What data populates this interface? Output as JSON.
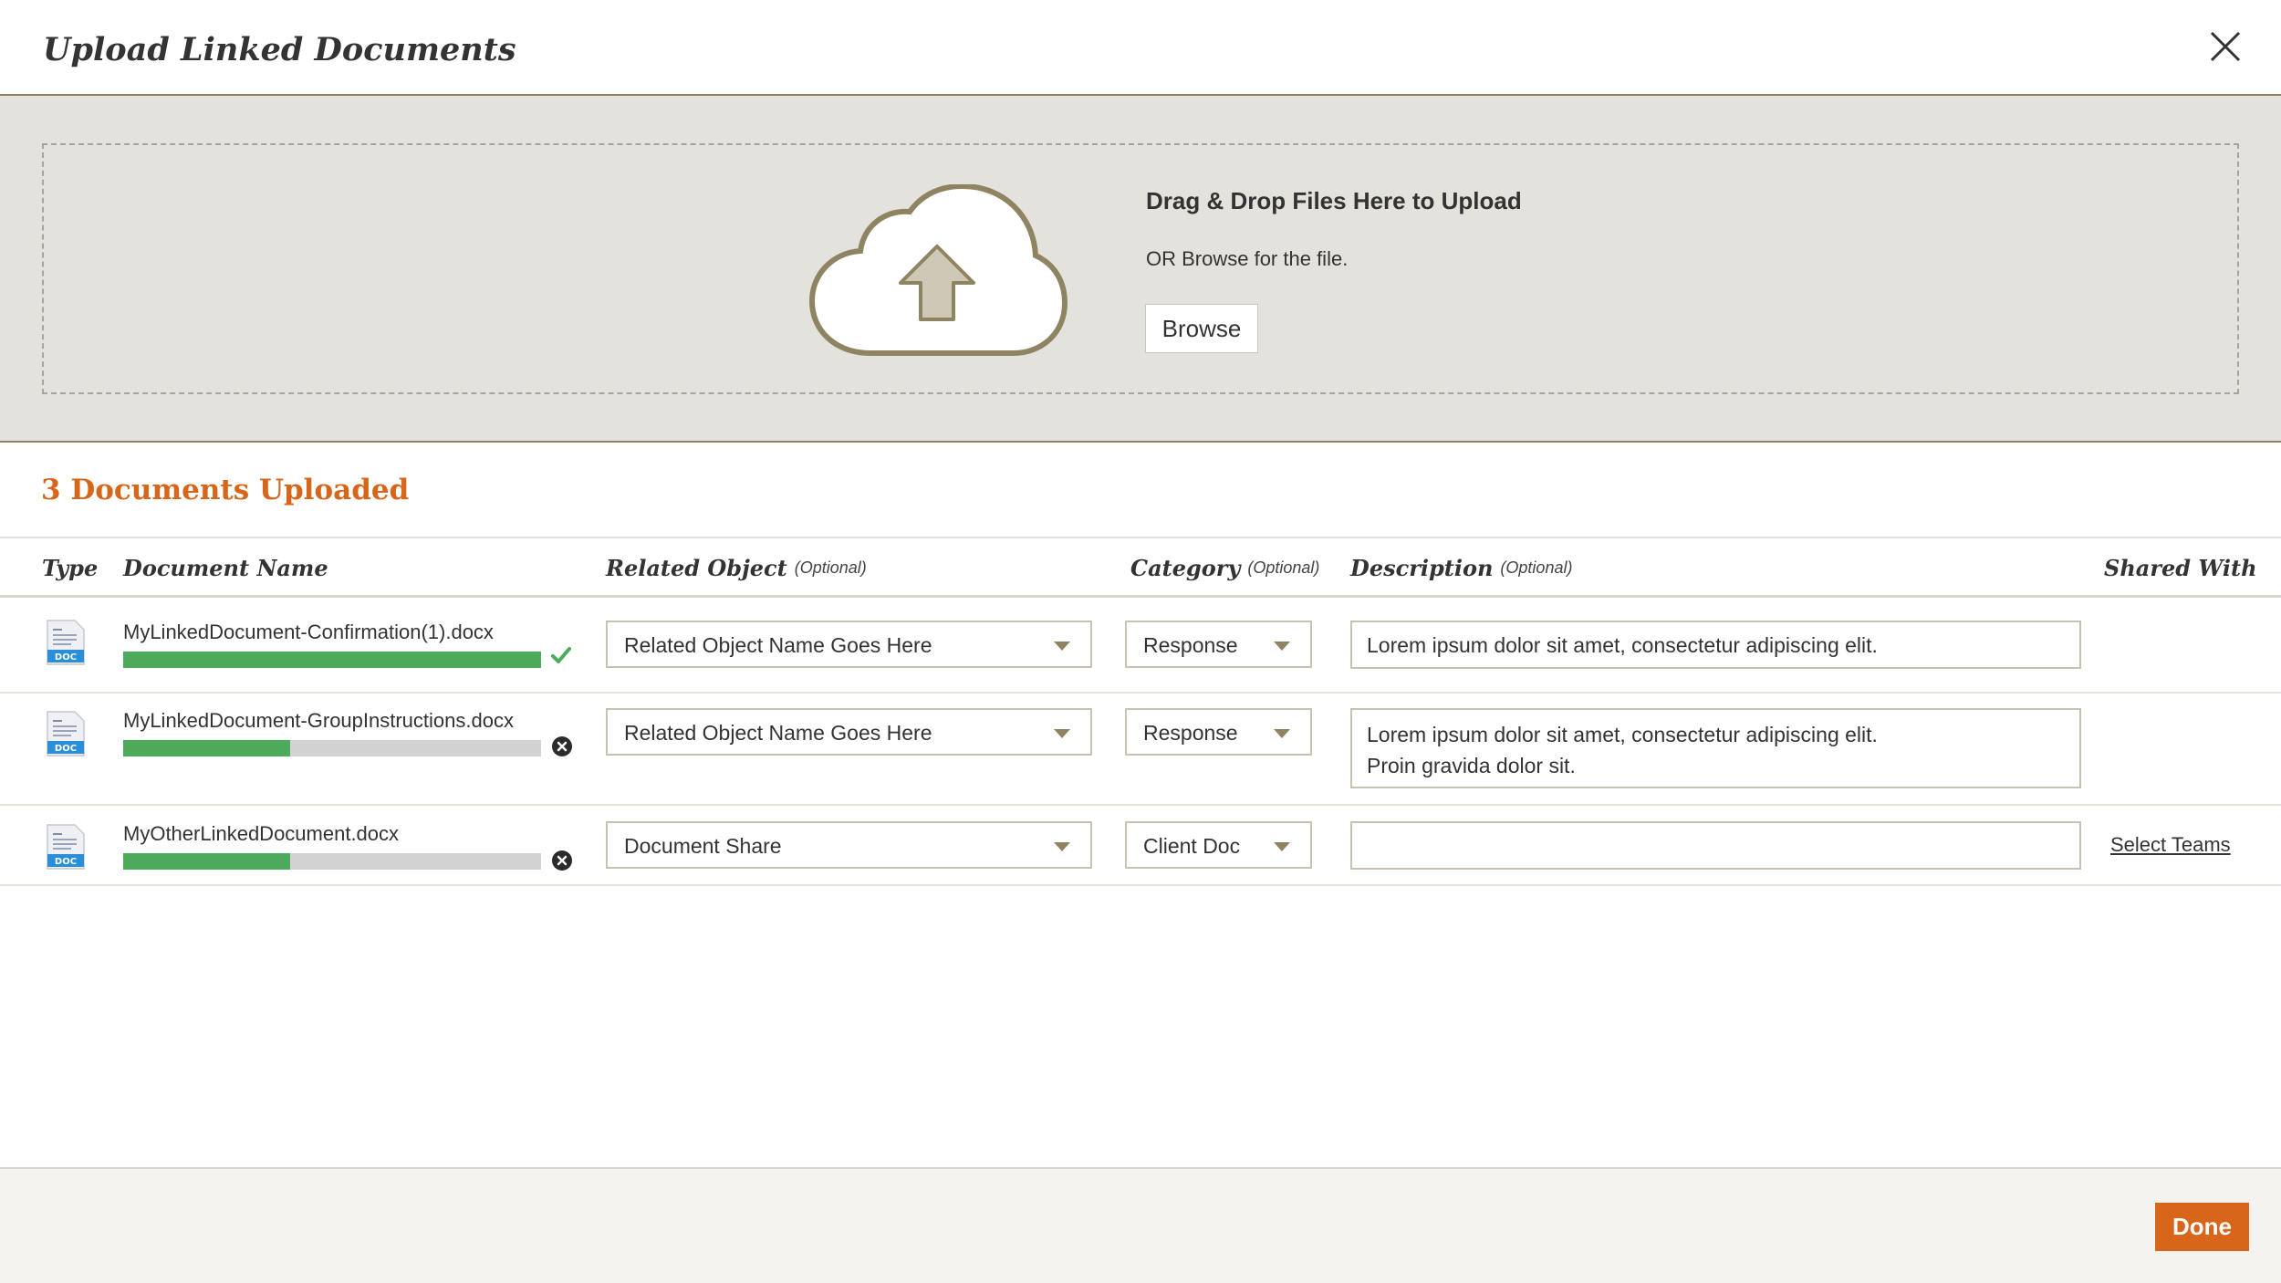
{
  "dialog": {
    "title": "Upload Linked Documents"
  },
  "upload": {
    "heading": "Drag & Drop Files Here to Upload",
    "subtext": "OR Browse for the file.",
    "browse_label": "Browse"
  },
  "uploaded": {
    "title": "3 Documents Uploaded"
  },
  "table": {
    "headers": {
      "type": "Type",
      "name": "Document Name",
      "related": "Related Object",
      "category": "Category",
      "description": "Description",
      "shared": "Shared With",
      "optional": "(Optional)"
    },
    "rows": [
      {
        "file_type": "DOC",
        "name": "MyLinkedDocument-Confirmation(1).docx",
        "progress": 1.0,
        "status": "complete",
        "related_object": "Related Object Name Goes Here",
        "category": "Response",
        "description": "Lorem ipsum dolor sit amet, consectetur adipiscing elit.",
        "shared_with": ""
      },
      {
        "file_type": "DOC",
        "name": "MyLinkedDocument-GroupInstructions.docx",
        "progress": 0.4,
        "status": "uploading",
        "related_object": "Related Object Name Goes Here",
        "category": "Response",
        "description": "Lorem ipsum dolor sit amet, consectetur adipiscing elit.\nProin gravida dolor sit.",
        "shared_with": ""
      },
      {
        "file_type": "DOC",
        "name": "MyOtherLinkedDocument.docx",
        "progress": 0.4,
        "status": "uploading",
        "related_object": "Document Share",
        "category": "Client Doc",
        "description": "",
        "shared_with": "Select Teams"
      }
    ]
  },
  "footer": {
    "done_label": "Done"
  },
  "colors": {
    "accent": "#d8661a",
    "progress": "#4caa5b",
    "zone_bg": "#e4e2dc",
    "border": "#8f8462"
  }
}
